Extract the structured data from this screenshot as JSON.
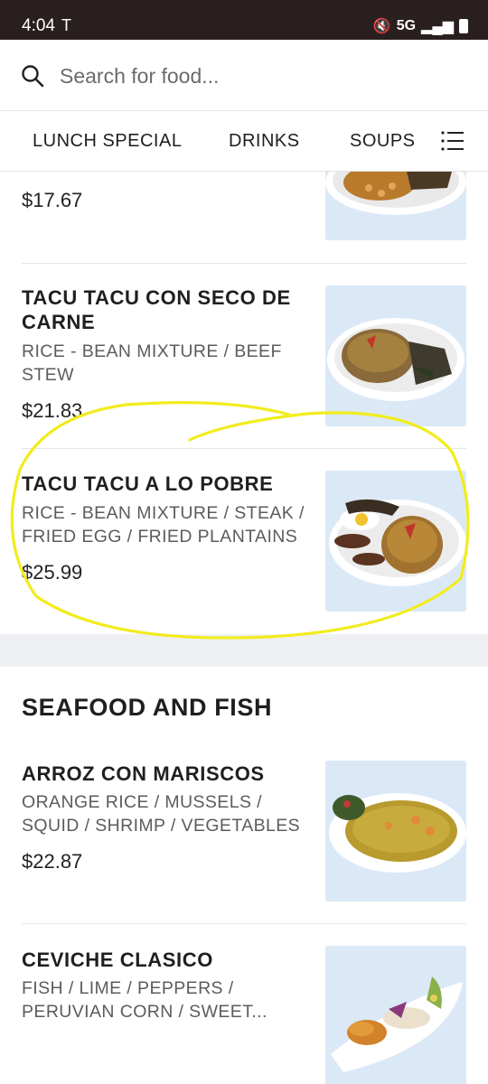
{
  "status_bar": {
    "time": "4:04",
    "network": "5G"
  },
  "search": {
    "placeholder": "Search for food..."
  },
  "tabs": [
    {
      "label": "LUNCH SPECIAL"
    },
    {
      "label": "DRINKS"
    },
    {
      "label": "SOUPS"
    }
  ],
  "items": [
    {
      "price": "$17.67"
    },
    {
      "title": "TACU TACU CON SECO DE CARNE",
      "description": "RICE - BEAN MIXTURE / BEEF STEW",
      "price": "$21.83"
    },
    {
      "title": "TACU TACU A LO POBRE",
      "description": "RICE - BEAN MIXTURE / STEAK / FRIED EGG / FRIED PLANTAINS",
      "price": "$25.99"
    }
  ],
  "seafood_section": {
    "title": "SEAFOOD AND FISH",
    "items": [
      {
        "title": "ARROZ CON MARISCOS",
        "description": "ORANGE RICE / MUSSELS / SQUID / SHRIMP / VEGETABLES",
        "price": "$22.87"
      },
      {
        "title": "CEVICHE CLASICO",
        "description": "FISH / LIME / PEPPERS / PERUVIAN CORN / SWEET..."
      }
    ]
  },
  "colors": {
    "highlight": "#f2ec1e",
    "thumb_bg": "#dbe9f7",
    "status_bar": "#2a1f1f"
  }
}
